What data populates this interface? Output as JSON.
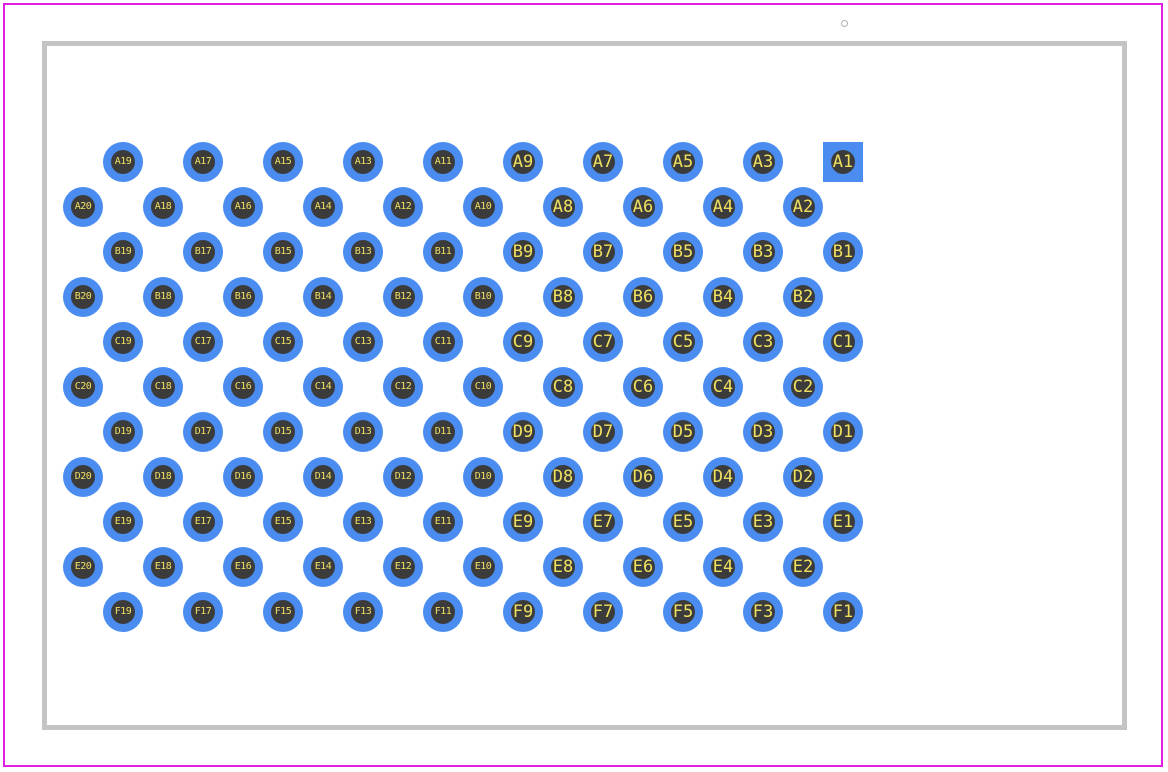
{
  "footprint": {
    "colors": {
      "pad": "#4a8cf0",
      "hole": "#3b3b3b",
      "label": "#f0e060",
      "outline": "#c4c4c4",
      "boundary": "#e020e0"
    },
    "rows": [
      {
        "name": "A",
        "odd": [
          "A19",
          "A17",
          "A15",
          "A13",
          "A11",
          "A9",
          "A7",
          "A5",
          "A3",
          "A1"
        ],
        "even": [
          "A20",
          "A18",
          "A16",
          "A14",
          "A12",
          "A10",
          "A8",
          "A6",
          "A4",
          "A2"
        ]
      },
      {
        "name": "B",
        "odd": [
          "B19",
          "B17",
          "B15",
          "B13",
          "B11",
          "B9",
          "B7",
          "B5",
          "B3",
          "B1"
        ],
        "even": [
          "B20",
          "B18",
          "B16",
          "B14",
          "B12",
          "B10",
          "B8",
          "B6",
          "B4",
          "B2"
        ]
      },
      {
        "name": "C",
        "odd": [
          "C19",
          "C17",
          "C15",
          "C13",
          "C11",
          "C9",
          "C7",
          "C5",
          "C3",
          "C1"
        ],
        "even": [
          "C20",
          "C18",
          "C16",
          "C14",
          "C12",
          "C10",
          "C8",
          "C6",
          "C4",
          "C2"
        ]
      },
      {
        "name": "D",
        "odd": [
          "D19",
          "D17",
          "D15",
          "D13",
          "D11",
          "D9",
          "D7",
          "D5",
          "D3",
          "D1"
        ],
        "even": [
          "D20",
          "D18",
          "D16",
          "D14",
          "D12",
          "D10",
          "D8",
          "D6",
          "D4",
          "D2"
        ]
      },
      {
        "name": "E",
        "odd": [
          "E19",
          "E17",
          "E15",
          "E13",
          "E11",
          "E9",
          "E7",
          "E5",
          "E3",
          "E1"
        ],
        "even": [
          "E20",
          "E18",
          "E16",
          "E14",
          "E12",
          "E10",
          "E8",
          "E6",
          "E4",
          "E2"
        ]
      },
      {
        "name": "F",
        "odd": [
          "F19",
          "F17",
          "F15",
          "F13",
          "F11",
          "F9",
          "F7",
          "F5",
          "F3",
          "F1"
        ]
      }
    ],
    "square_pad": "A1"
  }
}
